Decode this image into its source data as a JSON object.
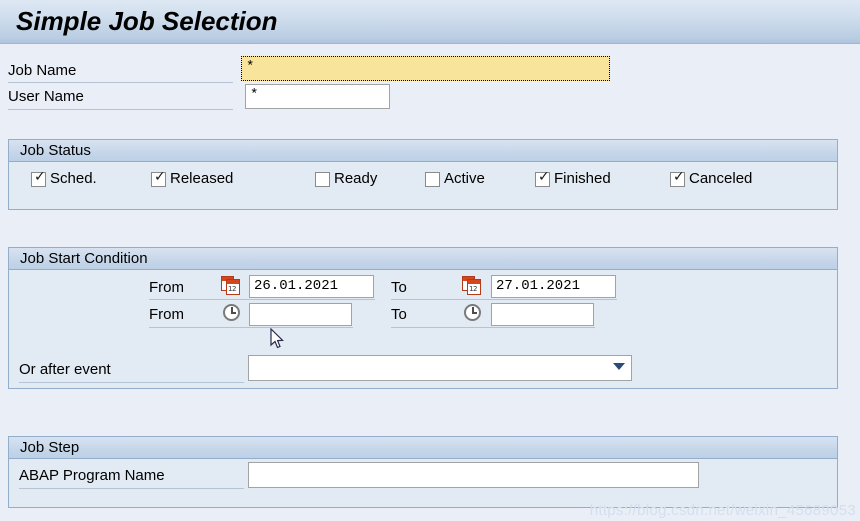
{
  "window": {
    "title": "Simple Job Selection"
  },
  "top_fields": [
    {
      "label": "Job Name",
      "value": "*",
      "placeholder": "",
      "focused": true,
      "name": "job-name"
    },
    {
      "label": "User Name",
      "value": "*",
      "placeholder": "",
      "focused": false,
      "name": "user-name"
    }
  ],
  "job_status": {
    "title": "Job Status",
    "checkboxes": [
      {
        "label": "Sched.",
        "checked": true,
        "mark": "✓",
        "name": "scheduled"
      },
      {
        "label": "Released",
        "checked": true,
        "mark": "✓",
        "name": "released"
      },
      {
        "label": "Ready",
        "checked": false,
        "mark": "",
        "name": "ready"
      },
      {
        "label": "Active",
        "checked": false,
        "mark": "",
        "name": "active"
      },
      {
        "label": "Finished",
        "checked": true,
        "mark": "✓",
        "name": "finished"
      },
      {
        "label": "Canceled",
        "checked": true,
        "mark": "✓",
        "name": "canceled"
      }
    ]
  },
  "job_start_condition": {
    "title": "Job Start Condition",
    "date_from_label": "From",
    "date_from_value": "26.01.2021",
    "date_to_label": "To",
    "date_to_value": "27.01.2021",
    "time_from_label": "From",
    "time_from_value": "",
    "time_to_label": "To",
    "time_to_value": "",
    "event_label": "Or after event",
    "event_value": "",
    "calendar_icon": "calendar-icon",
    "clock_icon": "clock-icon",
    "dropdown_icon": "chevron-down-icon"
  },
  "job_step": {
    "title": "Job Step",
    "program_label": "ABAP Program Name",
    "program_value": ""
  },
  "watermark": {
    "text": "https://blog.csdn.net/weixin_45689053"
  },
  "colors": {
    "background": "#eaeff7",
    "panel_bg": "#e2eaf3",
    "panel_border": "#93aecb",
    "focused_field": "#f8e49a",
    "calendar_accent": "#d4471c",
    "dropdown_arrow": "#2b4a7a"
  }
}
